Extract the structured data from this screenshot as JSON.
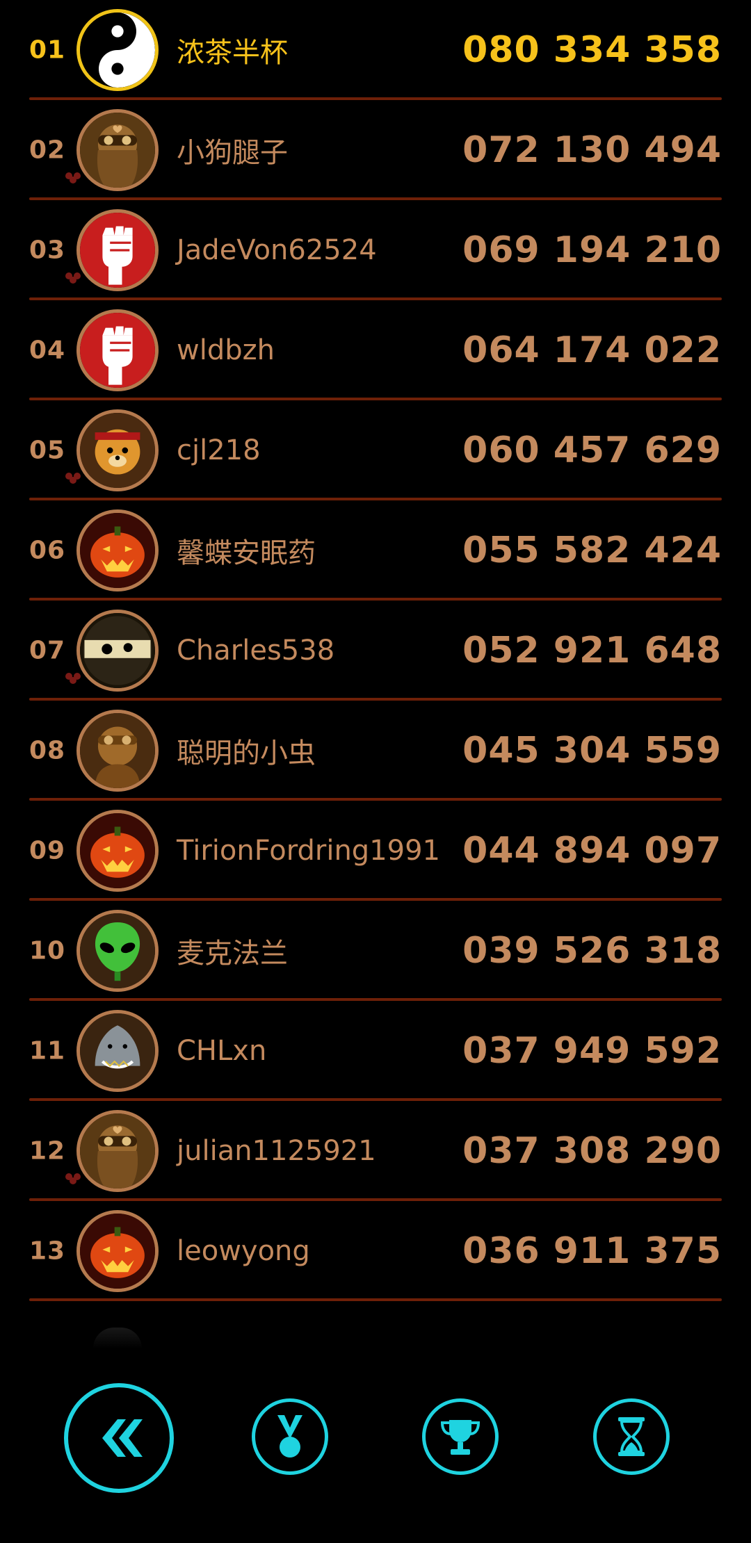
{
  "leaderboard": {
    "rows": [
      {
        "rank": "01",
        "name": "浓茶半杯",
        "score": "080 334 358",
        "avatar_icon": "yin-yang-icon",
        "group": false
      },
      {
        "rank": "02",
        "name": "小狗腿子",
        "score": "072 130 494",
        "avatar_icon": "pilot-woman-icon",
        "group": true
      },
      {
        "rank": "03",
        "name": "JadeVon62524",
        "score": "069 194 210",
        "avatar_icon": "raised-fist-icon",
        "group": true
      },
      {
        "rank": "04",
        "name": "wldbzh",
        "score": "064 174 022",
        "avatar_icon": "raised-fist-icon",
        "group": false
      },
      {
        "rank": "05",
        "name": "cjl218",
        "score": "060 457 629",
        "avatar_icon": "tiger-icon",
        "group": true
      },
      {
        "rank": "06",
        "name": "馨蝶安眠药",
        "score": "055 582 424",
        "avatar_icon": "pumpkin-icon",
        "group": false
      },
      {
        "rank": "07",
        "name": "Charles538",
        "score": "052 921 648",
        "avatar_icon": "ninja-icon",
        "group": true
      },
      {
        "rank": "08",
        "name": "聪明的小虫",
        "score": "045 304 559",
        "avatar_icon": "pilot-man-icon",
        "group": false
      },
      {
        "rank": "09",
        "name": "TirionFordring1991",
        "score": "044 894 097",
        "avatar_icon": "pumpkin-icon",
        "group": false
      },
      {
        "rank": "10",
        "name": "麦克法兰",
        "score": "039 526 318",
        "avatar_icon": "alien-icon",
        "group": false
      },
      {
        "rank": "11",
        "name": "CHLxn",
        "score": "037 949 592",
        "avatar_icon": "shark-icon",
        "group": false
      },
      {
        "rank": "12",
        "name": "julian1125921",
        "score": "037 308 290",
        "avatar_icon": "pilot-woman-icon",
        "group": true
      },
      {
        "rank": "13",
        "name": "leowyong",
        "score": "036 911 375",
        "avatar_icon": "pumpkin-icon",
        "group": false
      }
    ]
  },
  "bottom_nav": {
    "buttons": [
      "back-double-chevron-icon",
      "medal-icon",
      "trophy-icon",
      "hourglass-icon"
    ]
  },
  "colors": {
    "first_place": "#f7c21b",
    "text": "#c48a5e",
    "separator": "#6e2008",
    "nav_accent": "#1fd3e0"
  }
}
